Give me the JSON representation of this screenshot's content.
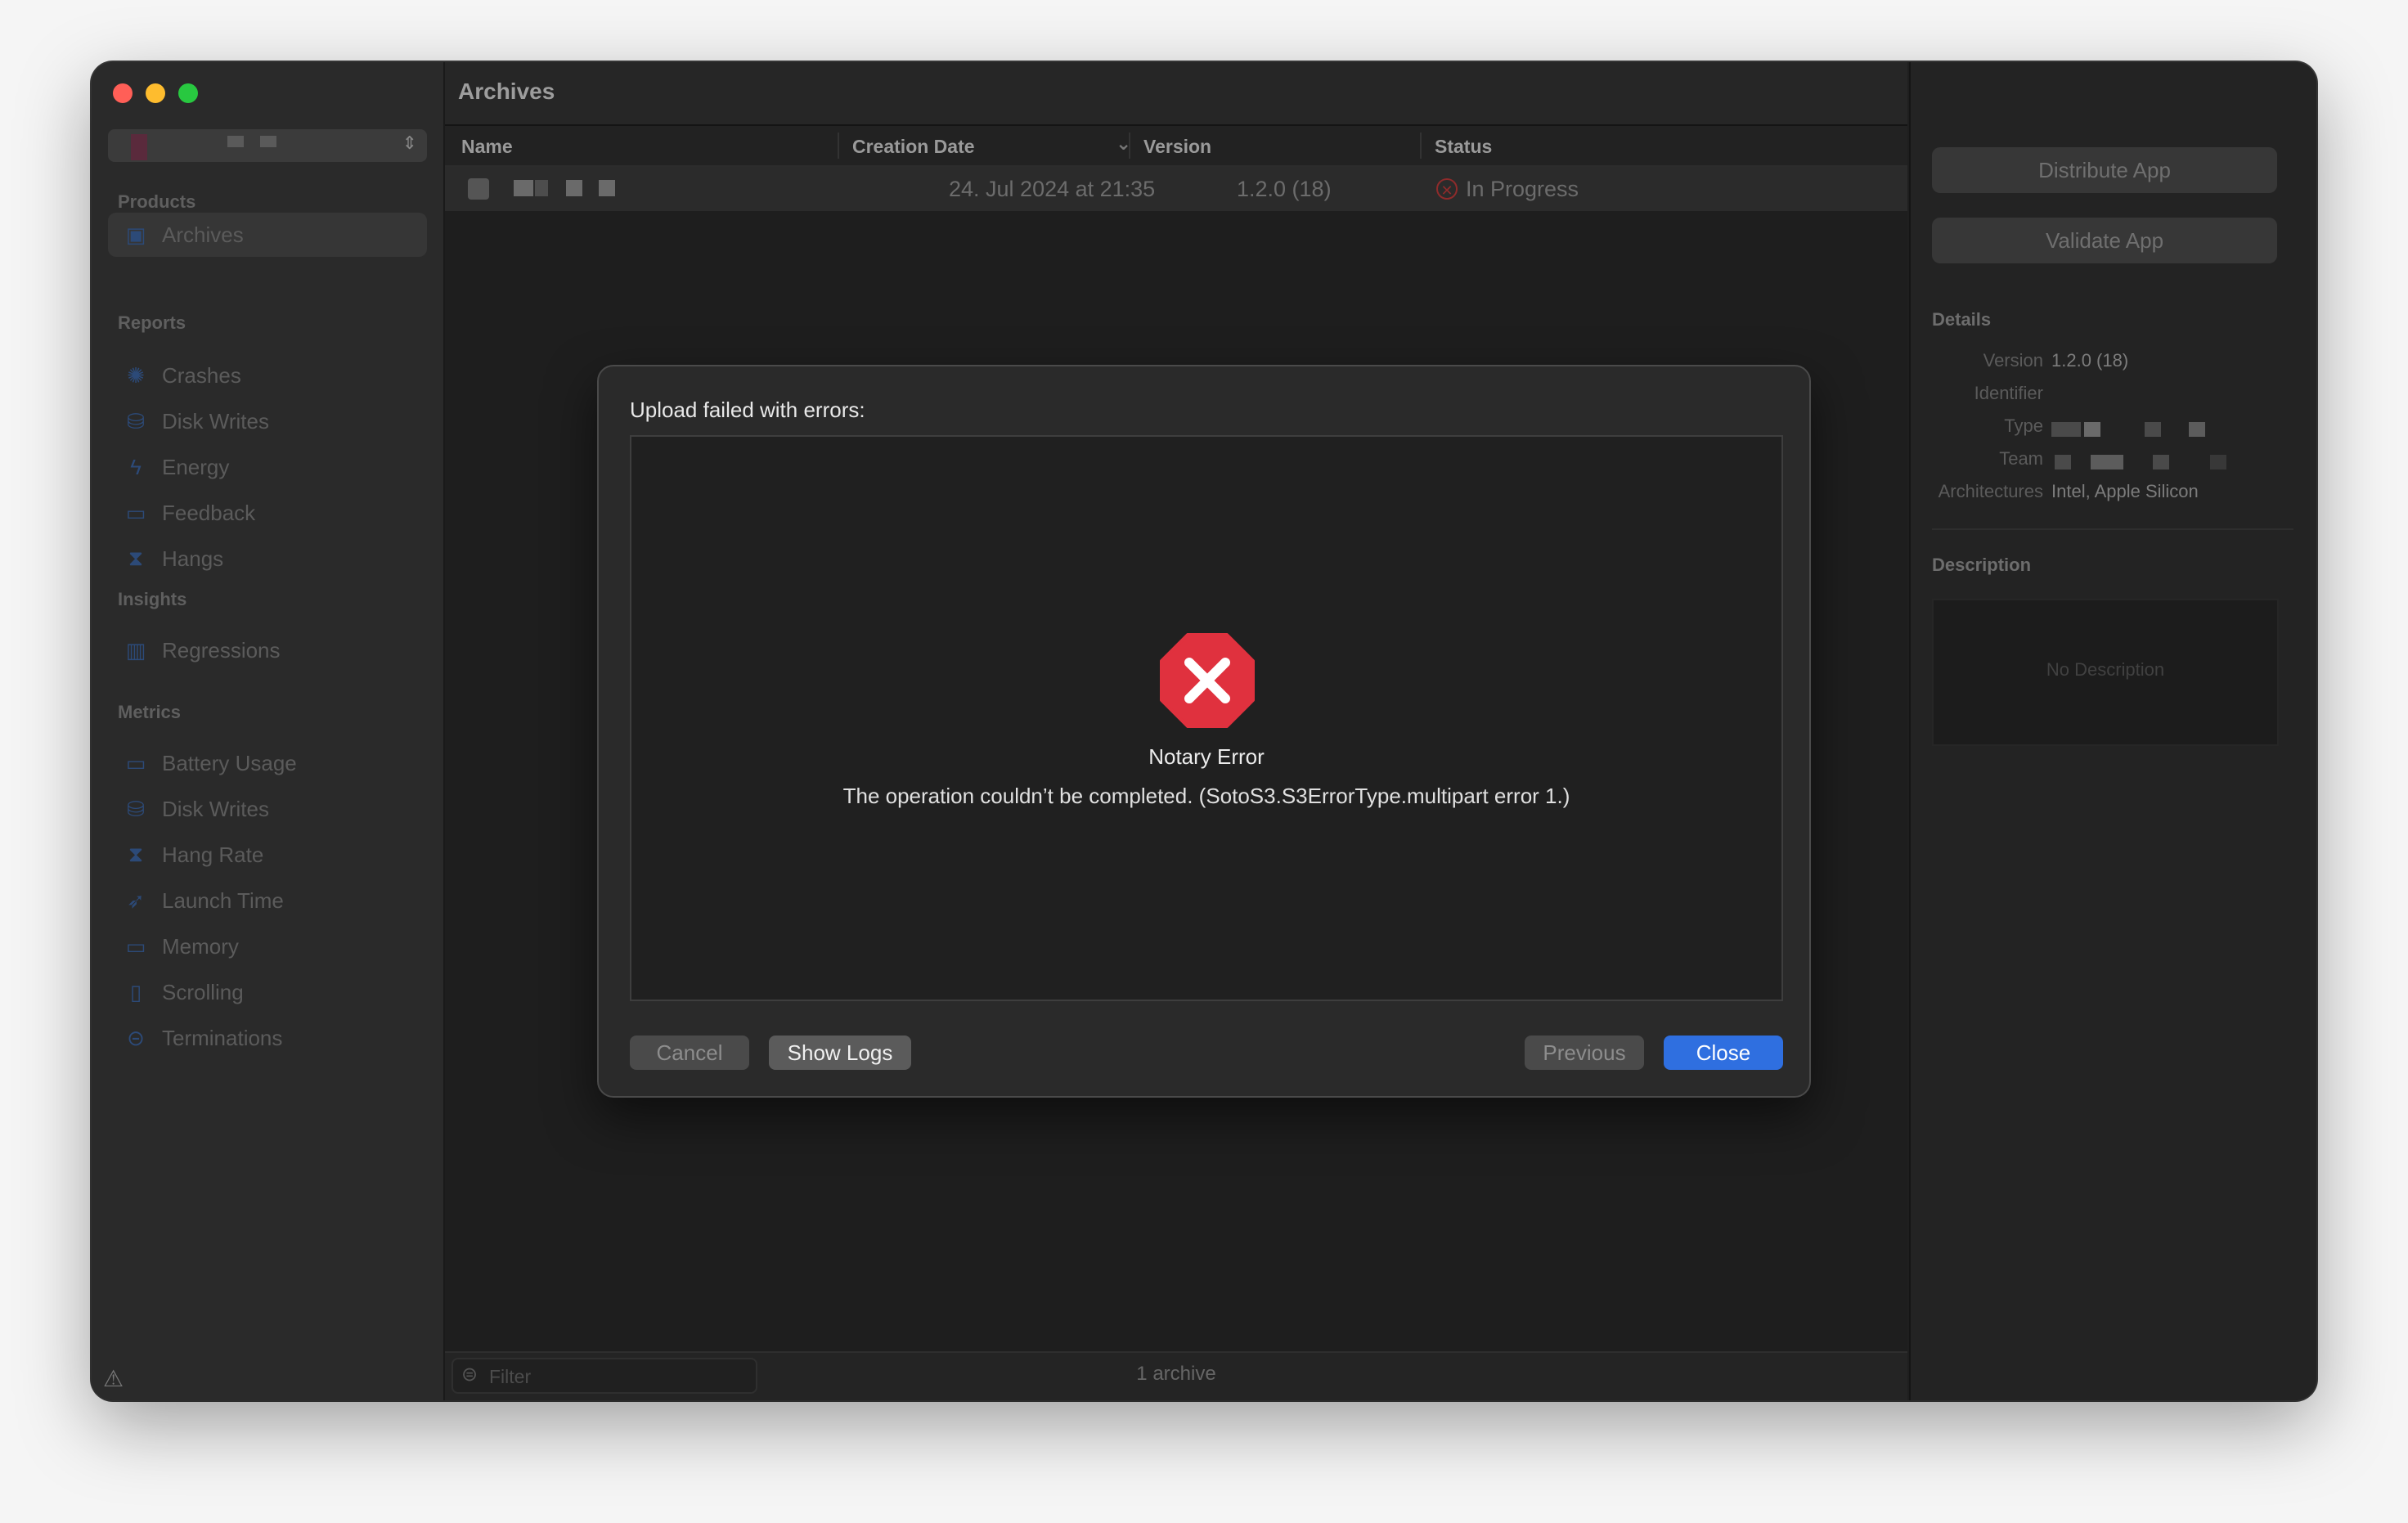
{
  "window": {
    "title": "Archives"
  },
  "sidebar": {
    "sections": {
      "products": "Products",
      "reports": "Reports",
      "insights": "Insights",
      "metrics": "Metrics"
    },
    "products_items": [
      {
        "label": "Archives",
        "icon": "archive-box-icon",
        "selected": true
      }
    ],
    "reports_items": [
      {
        "label": "Crashes",
        "icon": "crash-icon"
      },
      {
        "label": "Disk Writes",
        "icon": "disk-icon"
      },
      {
        "label": "Energy",
        "icon": "bolt-icon"
      },
      {
        "label": "Feedback",
        "icon": "feedback-icon"
      },
      {
        "label": "Hangs",
        "icon": "hourglass-icon"
      }
    ],
    "insights_items": [
      {
        "label": "Regressions",
        "icon": "bar-chart-icon"
      }
    ],
    "metrics_items": [
      {
        "label": "Battery Usage",
        "icon": "battery-icon"
      },
      {
        "label": "Disk Writes",
        "icon": "disk-icon"
      },
      {
        "label": "Hang Rate",
        "icon": "hourglass-icon"
      },
      {
        "label": "Launch Time",
        "icon": "rocket-icon"
      },
      {
        "label": "Memory",
        "icon": "memory-icon"
      },
      {
        "label": "Scrolling",
        "icon": "scroll-icon"
      },
      {
        "label": "Terminations",
        "icon": "termination-icon"
      }
    ]
  },
  "table": {
    "columns": {
      "name": "Name",
      "creation_date": "Creation Date",
      "version": "Version",
      "status": "Status"
    },
    "rows": [
      {
        "date": "24. Jul 2024 at 21:35",
        "version": "1.2.0 (18)",
        "status": "In Progress"
      }
    ]
  },
  "footer": {
    "filter_placeholder": "Filter",
    "archive_count": "1 archive"
  },
  "inspector": {
    "distribute_label": "Distribute App",
    "validate_label": "Validate App",
    "details_heading": "Details",
    "details": {
      "version_label": "Version",
      "version_value": "1.2.0 (18)",
      "identifier_label": "Identifier",
      "type_label": "Type",
      "team_label": "Team",
      "architectures_label": "Architectures",
      "architectures_value": "Intel, Apple Silicon"
    },
    "description_heading": "Description",
    "description_placeholder": "No Description"
  },
  "dialog": {
    "title": "Upload failed with errors:",
    "error_title": "Notary Error",
    "error_message": "The operation couldn’t be completed. (SotoS3.S3ErrorType.multipart error 1.)",
    "buttons": {
      "cancel": "Cancel",
      "show_logs": "Show Logs",
      "previous": "Previous",
      "close": "Close"
    }
  },
  "colors": {
    "error_red": "#e0313e",
    "accent_blue": "#2f6fe0"
  }
}
